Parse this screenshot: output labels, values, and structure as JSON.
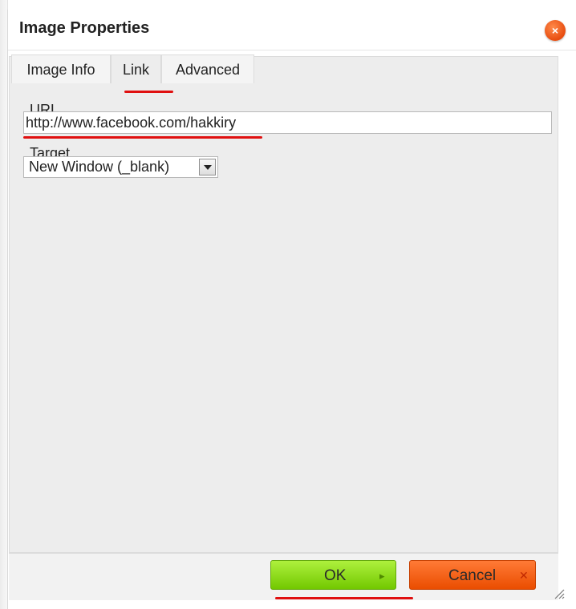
{
  "dialog": {
    "title": "Image Properties",
    "close_icon": "close-x",
    "close_glyph": "×"
  },
  "tabs": [
    {
      "label": "Image Info",
      "active": false
    },
    {
      "label": "Link",
      "active": true
    },
    {
      "label": "Advanced",
      "active": false
    }
  ],
  "link": {
    "url_label": "URL",
    "url_value": "http://www.facebook.com/hakkiry",
    "target_label": "Target",
    "target_value": "New Window (_blank)"
  },
  "buttons": {
    "ok_label": "OK",
    "ok_icon": "play-arrow",
    "ok_glyph": "▸",
    "cancel_label": "Cancel",
    "cancel_icon": "close-x",
    "cancel_glyph": "✕"
  },
  "colors": {
    "ok_button": "#8fe01f",
    "cancel_button": "#f2600f",
    "close_button": "#e84d10",
    "annotation": "#e01010"
  }
}
